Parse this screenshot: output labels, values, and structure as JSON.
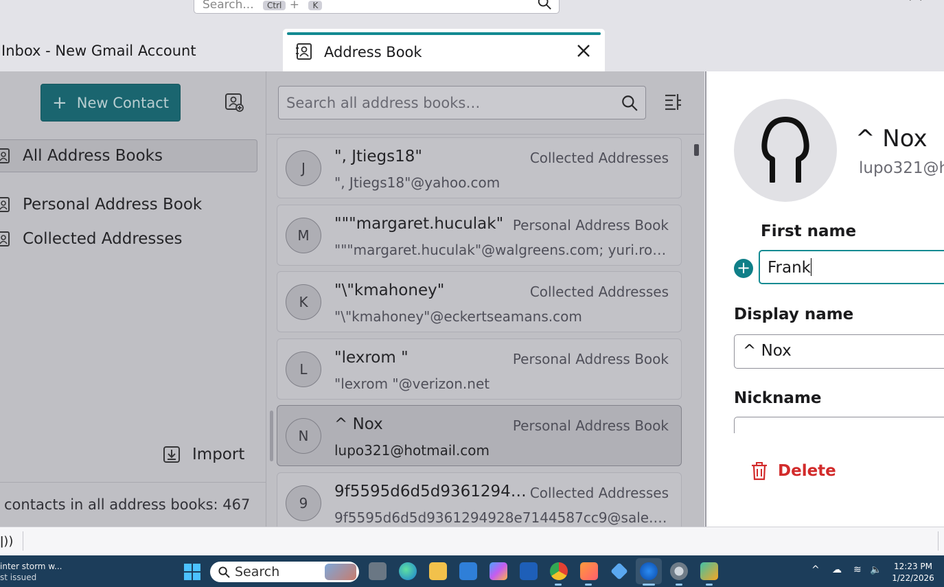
{
  "window": {
    "search_placeholder": "Search...",
    "search_shortcut_key1": "Ctrl",
    "search_shortcut_plus": "+",
    "search_shortcut_key2": "K"
  },
  "tabs": [
    {
      "label": "Inbox - New Gmail Account",
      "active": false
    },
    {
      "label": "Address Book",
      "active": true
    }
  ],
  "sidebar": {
    "new_contact_label": "New Contact",
    "books": [
      {
        "label": "All Address Books",
        "selected": true
      },
      {
        "label": "Personal Address Book",
        "selected": false
      },
      {
        "label": "Collected Addresses",
        "selected": false
      }
    ],
    "import_label": "Import",
    "contacts_count_text": "contacts in all address books: 467"
  },
  "list": {
    "search_placeholder": "Search all address books…",
    "contacts": [
      {
        "initial": "J",
        "name": "\", Jtiegs18\"",
        "book": "Collected Addresses",
        "email": "\", Jtiegs18\"@yahoo.com",
        "selected": false
      },
      {
        "initial": "M",
        "name": "\"\"\"margaret.huculak\"",
        "book": "Personal Address Book",
        "email": "\"\"\"margaret.huculak\"@walgreens.com; yuri.roze…",
        "selected": false
      },
      {
        "initial": "K",
        "name": "\"\\\"kmahoney\"",
        "book": "Collected Addresses",
        "email": "\"\\\"kmahoney\"@eckertseamans.com",
        "selected": false
      },
      {
        "initial": "L",
        "name": "\"lexrom \"",
        "book": "Personal Address Book",
        "email": "\"lexrom \"@verizon.net",
        "selected": false
      },
      {
        "initial": "N",
        "name": "^ Nox",
        "book": "Personal Address Book",
        "email": "lupo321@hotmail.com",
        "selected": true
      },
      {
        "initial": "9",
        "name": "9f5595d6d5d936129492…",
        "book": "Collected Addresses",
        "email": "9f5595d6d5d9361294928e7144587cc9@sale.cr…",
        "selected": false
      }
    ]
  },
  "editor": {
    "display_name": "^ Nox",
    "email_preview": "lupo321@h",
    "first_name_label": "First name",
    "first_name_value": "Frank",
    "display_name_label": "Display name",
    "display_name_value": "^ Nox",
    "nickname_label": "Nickname",
    "delete_label": "Delete"
  },
  "taskbar": {
    "weather_line1": "inter storm w...",
    "weather_line2": "st issued",
    "search_label": "Search",
    "time": "12:23 PM",
    "date": "1/22/2026"
  },
  "colors": {
    "accent": "#138a92",
    "new_contact_bg": "#0f6b74",
    "delete_red": "#d22b2b",
    "taskbar_bg": "#1c3d5a"
  }
}
